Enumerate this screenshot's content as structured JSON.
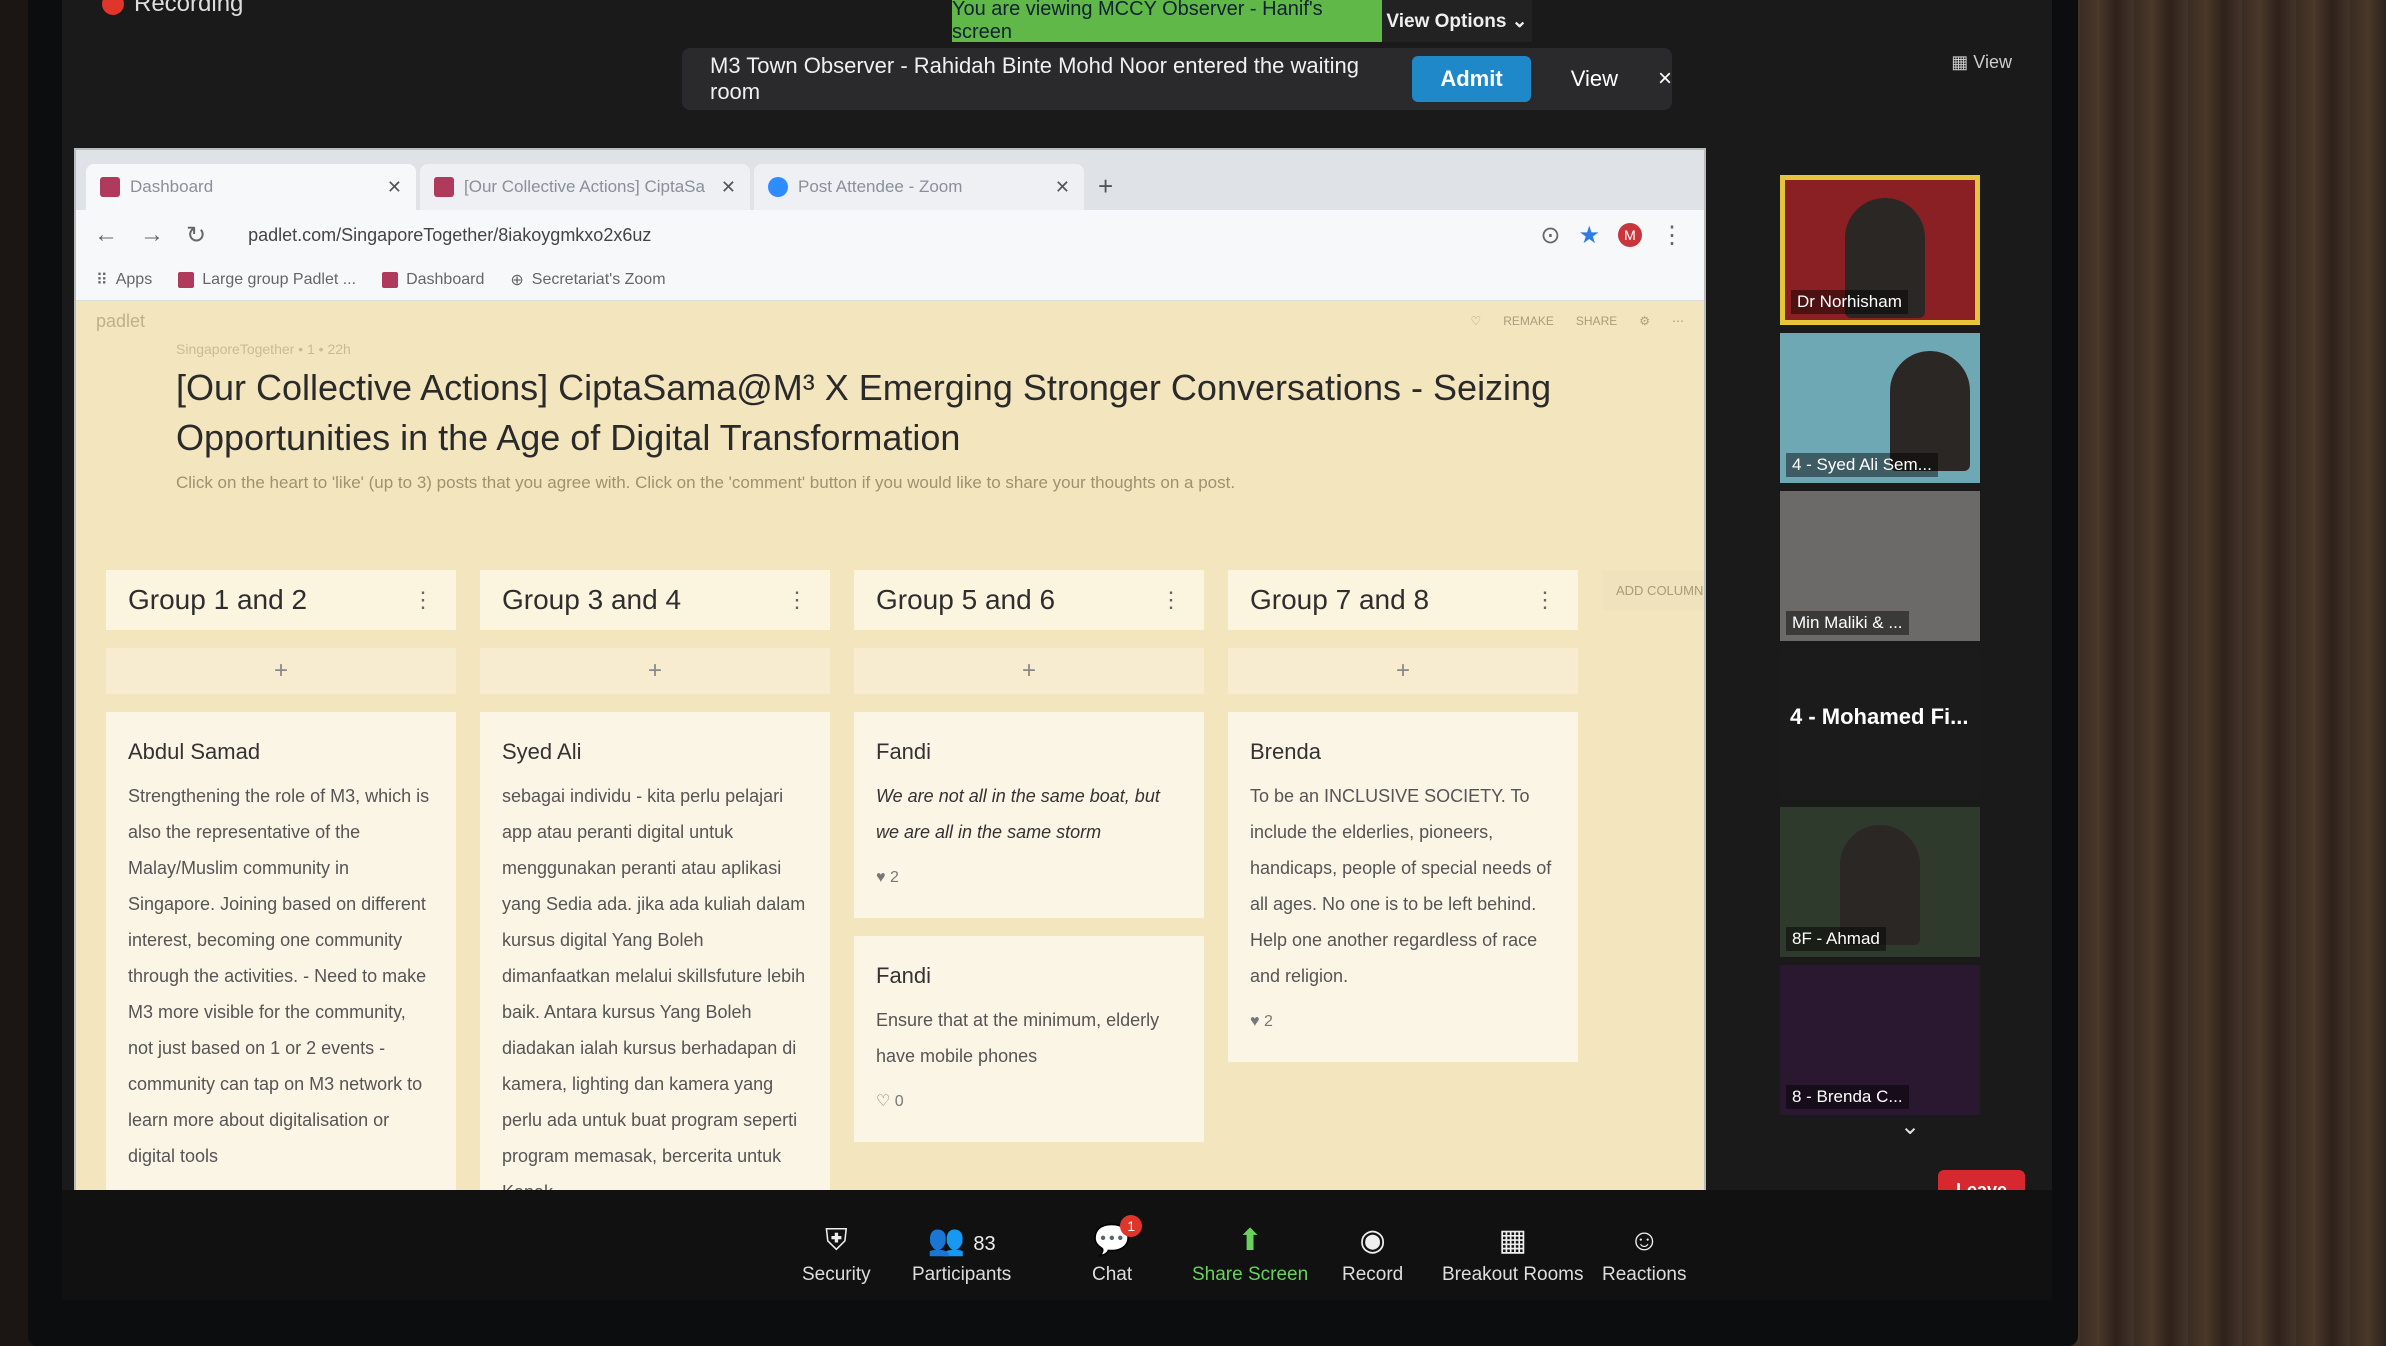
{
  "zoom": {
    "recording": "Recording",
    "viewing_banner": "You are viewing MCCY Observer - Hanif's screen",
    "view_options": "View Options ⌄",
    "notification": "M3 Town Observer - Rahidah Binte Mohd Noor entered the waiting room",
    "admit": "Admit",
    "view": "View",
    "close": "×",
    "grid_view": "View",
    "leave": "Leave",
    "participants": [
      {
        "name": "Dr Norhisham",
        "active": true
      },
      {
        "name": "4 - Syed Ali Sem..."
      },
      {
        "name": "Min Maliki & ..."
      },
      {
        "name": "4 - Mohamed Fi..."
      },
      {
        "name": "8F - Ahmad"
      },
      {
        "name": "8 - Brenda C..."
      }
    ],
    "toolbar": {
      "security": "Security",
      "participants": "Participants",
      "participants_count": "83",
      "chat": "Chat",
      "chat_badge": "1",
      "share": "Share Screen",
      "record": "Record",
      "breakout": "Breakout Rooms",
      "reactions": "Reactions"
    }
  },
  "browser": {
    "tabs": [
      {
        "title": "Dashboard"
      },
      {
        "title": "[Our Collective Actions] CiptaSa"
      },
      {
        "title": "Post Attendee - Zoom"
      }
    ],
    "url": "padlet.com/SingaporeTogether/8iakoygmkxo2x6uz",
    "bookmarks": [
      "Apps",
      "Large group Padlet ...",
      "Dashboard",
      "Secretariat's Zoom"
    ]
  },
  "padlet": {
    "logo": "padlet",
    "actions": [
      "♡",
      "REMAKE",
      "SHARE",
      "⚙",
      "⋯"
    ],
    "meta": "SingaporeTogether • 1 • 22h",
    "title": "[Our Collective Actions] CiptaSama@M³ X Emerging Stronger Conversations - Seizing Opportunities in the Age of Digital Transformation",
    "subtitle": "Click on the heart to 'like' (up to 3) posts that you agree with. Click on the 'comment' button if you would like to share your thoughts on a post.",
    "add_column": "ADD COLUMN",
    "columns": [
      {
        "title": "Group 1 and 2",
        "posts": [
          {
            "author": "Abdul Samad",
            "body": "Strengthening the role of M3, which is also the representative of the Malay/Muslim community in Singapore. Joining based on different interest, becoming one community through the activities. - Need to make M3 more visible for the community, not just based on 1 or 2 events - community can tap on M3 network to learn more about digitalisation or digital tools",
            "likes": ""
          }
        ]
      },
      {
        "title": "Group 3 and 4",
        "posts": [
          {
            "author": "Syed Ali",
            "body": "sebagai individu - kita perlu pelajari app atau peranti digital untuk menggunakan peranti atau aplikasi yang Sedia ada. jika ada kuliah dalam kursus digital Yang Boleh dimanfaatkan melalui skillsfuture lebih baik. Antara kursus Yang Boleh diadakan ialah kursus berhadapan di kamera, lighting dan kamera yang perlu ada untuk buat program seperti program memasak, bercerita untuk Kanak",
            "likes": ""
          }
        ]
      },
      {
        "title": "Group 5 and 6",
        "posts": [
          {
            "author": "Fandi",
            "body": "We are not all in the same boat, but we are all in the same storm",
            "likes": "♥ 2"
          },
          {
            "author": "Fandi",
            "body": "Ensure that at the minimum, elderly have mobile phones",
            "likes": "♡ 0"
          }
        ]
      },
      {
        "title": "Group 7 and 8",
        "posts": [
          {
            "author": "Brenda",
            "body": "To be an INCLUSIVE SOCIETY. To include the elderlies, pioneers, handicaps, people of special needs of all ages. No one is to be left behind. Help one another regardless of race and religion.",
            "likes": "♥ 2"
          }
        ]
      }
    ]
  }
}
